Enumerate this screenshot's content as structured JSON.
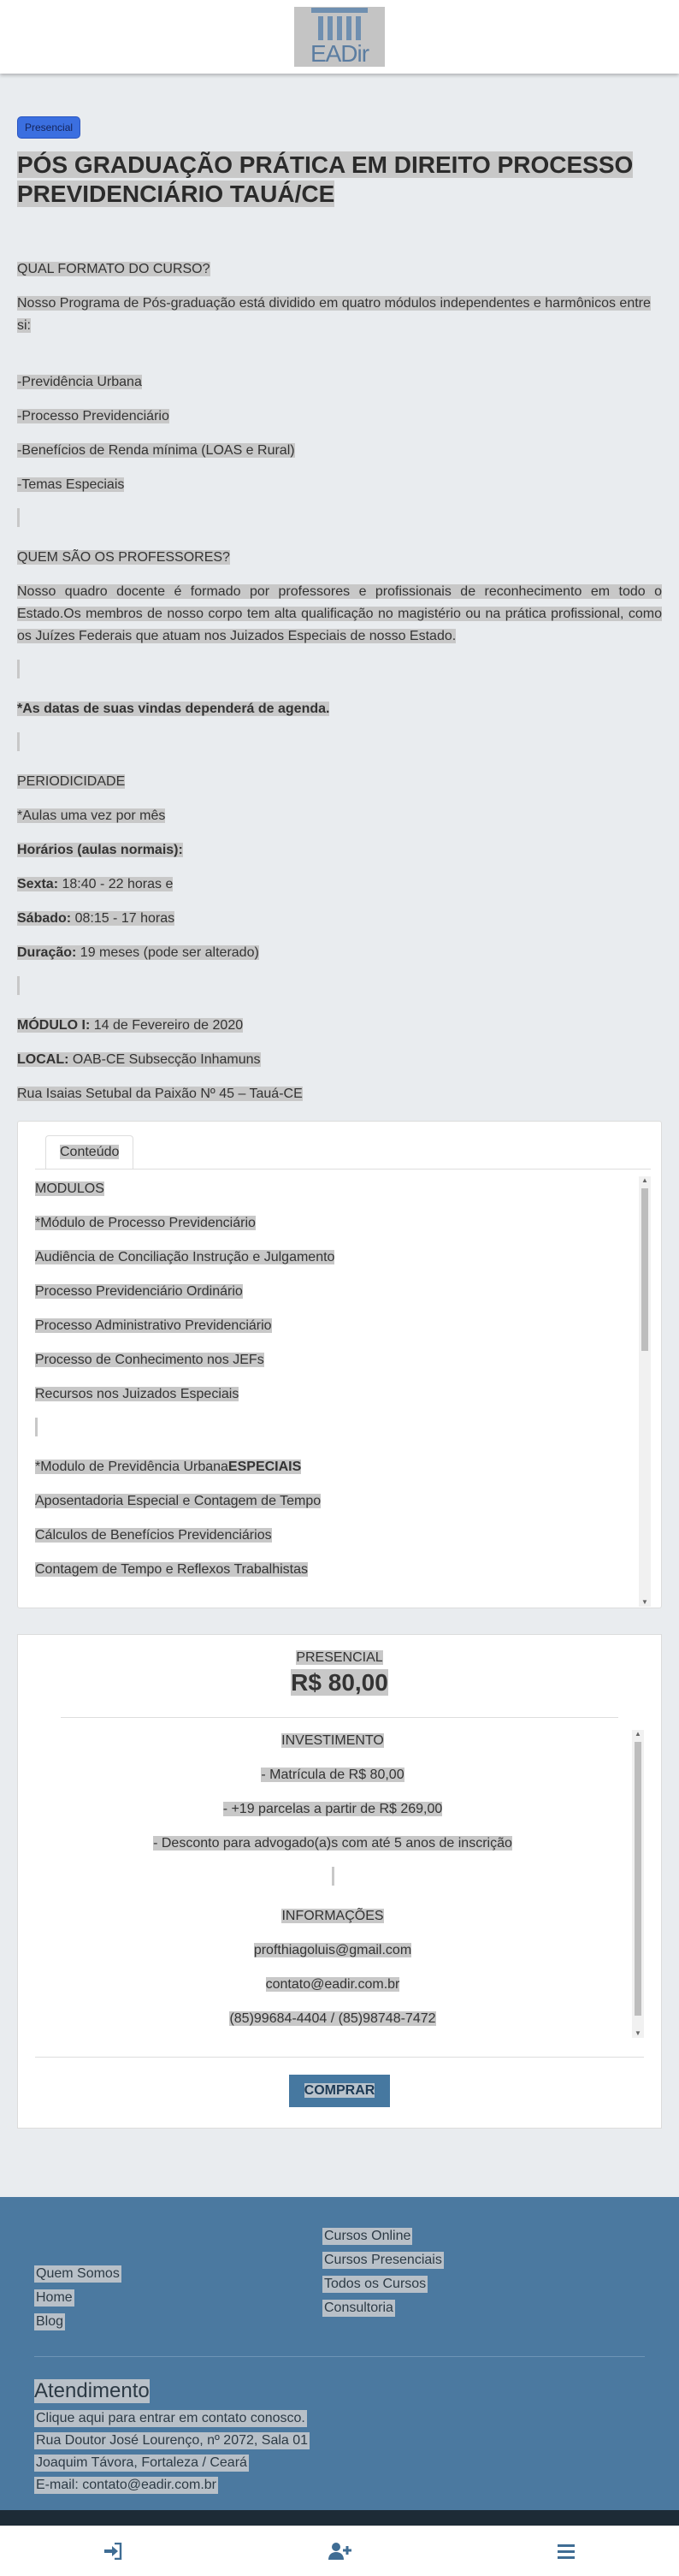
{
  "header": {
    "logo_text": "EADir"
  },
  "course": {
    "badge": "Presencial",
    "title": "PÓS GRADUAÇÃO PRÁTICA EM DIREITO PROCESSO PREVIDENCIÁRIO TAUÁ/CE",
    "q_format": "QUAL FORMATO DO CURSO?",
    "format_text": "  Nosso Programa de Pós-graduação está dividido em quatro módulos independentes e harmônicos entre si:",
    "modules": [
      " -Previdência Urbana",
      " -Processo Previdenciário",
      " -Benefícios de Renda mínima (LOAS e Rural)",
      " -Temas Especiais"
    ],
    "q_professors": "QUEM SÃO OS PROFESSORES?",
    "professors_text": "  Nosso quadro docente é formado por professores e profissionais de reconhecimento em todo o Estado.Os membros de nosso corpo tem alta qualificação no magistério ou na prática profissional, como os Juízes Federais que atuam nos Juizados Especiais de nosso Estado.",
    "agenda_note": "*As datas de suas vindas dependerá de agenda.",
    "periodicity_title": "PERIODICIDADE",
    "periodicity_text": " *Aulas uma vez por mês",
    "schedule_title": "Horários (aulas normais):",
    "sexta_label": "Sexta:",
    "sexta_value": " 18:40 - 22 horas e",
    "sabado_label": "Sábado:",
    "sabado_value": " 08:15 - 17 horas",
    "duracao_label": "Duração:",
    "duracao_value": " 19 meses (pode ser alterado)",
    "modulo_label": "MÓDULO I:",
    "modulo_value": " 14 de Fevereiro de 2020",
    "local_label": "LOCAL:",
    "local_value": " OAB-CE Subsecção Inhamuns",
    "address": "Rua Isaias Setubal da Paixão Nº 45 – Tauá-CE"
  },
  "tabs": {
    "tab_label": "Conteúdo",
    "items": [
      "MODULOS",
      "*Módulo de Processo Previdenciário",
      "Audiência de Conciliação Instrução e Julgamento",
      "Processo Previdenciário Ordinário",
      "Processo Administrativo Previdenciário",
      "Processo de Conhecimento nos JEFs",
      "Recursos nos Juizados Especiais"
    ],
    "urban_prefix": "*Modulo de Previdência Urbana",
    "urban_bold": "ESPECIAIS",
    "items2": [
      "Aposentadoria Especial e Contagem de Tempo",
      "Cálculos de Benefícios Previdenciários",
      "Contagem de Tempo e Reflexos Trabalhistas"
    ]
  },
  "pricing": {
    "mode": "PRESENCIAL",
    "price": "R$ 80,00",
    "invest_title": "INVESTIMENTO",
    "invest_items": [
      "- Matrícula de R$ 80,00",
      "- +19 parcelas a partir de R$ 269,00",
      "- Desconto para advogado(a)s com até 5 anos de inscrição"
    ],
    "info_title": "INFORMAÇÕES",
    "info_items": [
      "profthiagoluis@gmail.com",
      "contato@eadir.com.br",
      "(85)99684-4404 / (85)98748-7472"
    ],
    "buy_label": "COMPRAR"
  },
  "footer": {
    "links_left": [
      "Quem Somos",
      "Home",
      "Blog"
    ],
    "links_right": [
      "Cursos Online",
      "Cursos Presenciais",
      "Todos os Cursos",
      "Consultoria"
    ],
    "atend_title": "Atendimento",
    "atend_lines": [
      "Clique aqui para entrar em contato conosco.",
      "Rua Doutor José Lourenço, nº 2072, Sala 01",
      "Joaquim Távora, Fortaleza / Ceará",
      "E-mail: contato@eadir.com.br"
    ]
  },
  "bottom_nav": {
    "icons": [
      "sign-in-icon",
      "user-plus-icon",
      "menu-icon"
    ]
  }
}
